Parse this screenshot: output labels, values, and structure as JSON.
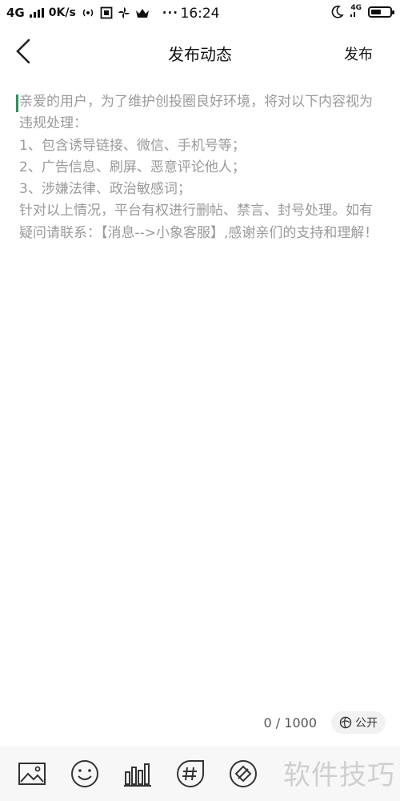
{
  "status_bar": {
    "network": "4G",
    "speed": "0K/s",
    "time": "16:24",
    "net_tag": "4G",
    "battery_level": 0.55
  },
  "header": {
    "title": "发布动态",
    "publish_label": "发布"
  },
  "editor": {
    "placeholder": "亲爱的用户，为了维护创投圈良好环境，将对以下内容视为违规处理：\n1、包含诱导链接、微信、手机号等；\n2、广告信息、刷屏、恶意评论他人；\n3、涉嫌法律、政治敏感词；\n针对以上情况，平台有权进行删帖、禁言、封号处理。如有疑问请联系：【消息-->小象客服】,感谢亲们的支持和理解！"
  },
  "counter": "0 / 1000",
  "visibility": "公开",
  "toolbar": {
    "icons": [
      "image-icon",
      "emoji-icon",
      "chart-icon",
      "hashtag-icon",
      "link-icon"
    ]
  },
  "watermark": "软件技巧"
}
